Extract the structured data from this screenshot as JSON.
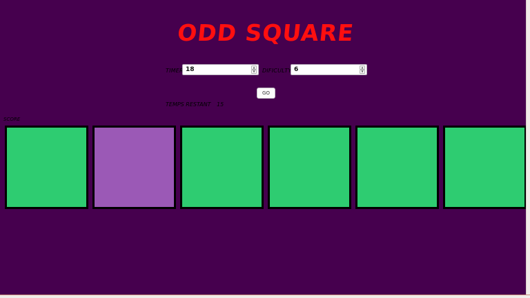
{
  "game": {
    "title": "ODD SQUARE",
    "timer_label": "TIMER",
    "timer_value": "18",
    "difficulty_label": "DIFICULTY",
    "difficulty_value": "6",
    "go_label": "GO",
    "time_remaining_label": "TEMPS RESTANT",
    "time_remaining_value": "15",
    "score_label": "SCORE"
  },
  "colors": {
    "background": "#46004e",
    "title": "#ff0f0f",
    "normal_square": "#2ecc71",
    "odd_square": "#9b59b6"
  },
  "squares": [
    {
      "kind": "normal",
      "color": "#2ecc71"
    },
    {
      "kind": "odd",
      "color": "#9b59b6"
    },
    {
      "kind": "normal",
      "color": "#2ecc71"
    },
    {
      "kind": "normal",
      "color": "#2ecc71"
    },
    {
      "kind": "normal",
      "color": "#2ecc71"
    },
    {
      "kind": "normal",
      "color": "#2ecc71"
    }
  ]
}
